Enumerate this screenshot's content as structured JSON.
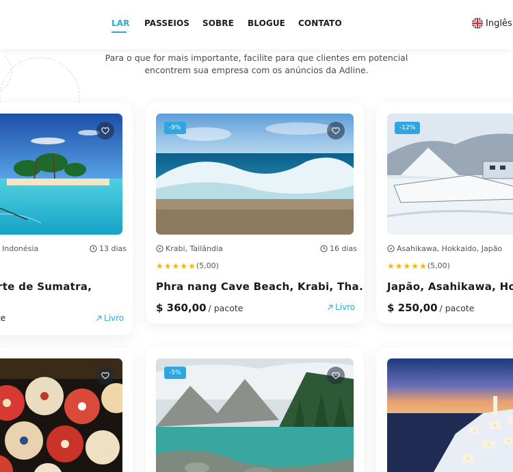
{
  "nav": {
    "items": [
      {
        "label": "LAR",
        "active": true
      },
      {
        "label": "PASSEIOS"
      },
      {
        "label": "SOBRE"
      },
      {
        "label": "BLOGUE"
      },
      {
        "label": "CONTATO"
      }
    ],
    "language": "Inglês"
  },
  "intro": {
    "line1": "Para o que for mais importante, facilite para que clientes em potencial",
    "line2": "encontrem sua empresa com os anúncios da Adline."
  },
  "colors": {
    "accent": "#2ea7e0",
    "star": "#f4b400"
  },
  "cards": [
    {
      "location": ", Indonésia",
      "duration": "13 dias",
      "title": "rte de Sumatra,",
      "price_tail": "te",
      "book": "Livro",
      "image": "tropical-beach"
    },
    {
      "badge": "-9%",
      "location": "Krabi, Tailândia",
      "duration": "16 dias",
      "rating": "(5,00)",
      "stars": 5,
      "title": "Phra nang Cave Beach, Krabi, Tha...",
      "price": "$ 360,00",
      "unit": "/ pacote",
      "book": "Livro",
      "image": "ocean-wave"
    },
    {
      "badge": "-12%",
      "location": "Asahikawa, Hokkaido, Japão",
      "rating": "(5,00)",
      "stars": 5,
      "title": "Japão, Asahikawa, Hokkaid",
      "price": "$ 250,00",
      "unit": "/ pacote",
      "image": "snow-boat"
    },
    {
      "image": "paper-umbrellas"
    },
    {
      "badge": "-5%",
      "image": "mountain-lake"
    },
    {
      "image": "santorini-night"
    }
  ]
}
